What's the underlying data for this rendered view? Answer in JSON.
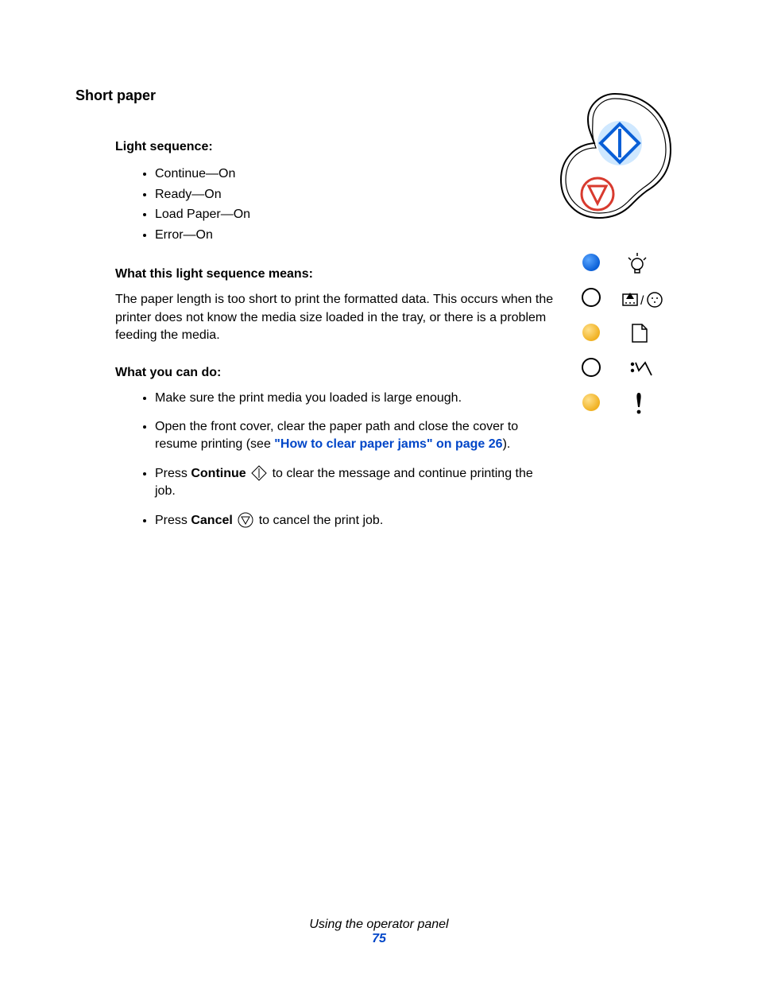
{
  "title": "Short paper",
  "light_sequence": {
    "heading": "Light sequence:",
    "items": [
      "Continue—On",
      "Ready—On",
      "Load Paper—On",
      "Error—On"
    ]
  },
  "meaning": {
    "heading": "What this light sequence means:",
    "text": "The paper length is too short to print the formatted data. This occurs when the printer does not know the media size loaded in the tray, or there is a problem feeding the media."
  },
  "actions": {
    "heading": "What you can do:",
    "item1": "Make sure the print media you loaded is large enough.",
    "item2_pre": "Open the front cover, clear the paper path and close the cover to resume printing (see ",
    "item2_link": "\"How to clear paper jams\" on page 26",
    "item2_post": ").",
    "item3_pre": "Press ",
    "item3_bold": "Continue",
    "item3_post": " to clear the message and continue printing the job.",
    "item4_pre": "Press ",
    "item4_bold": "Cancel",
    "item4_post": " to cancel the print job."
  },
  "footer": {
    "section": "Using the operator panel",
    "page": "75"
  }
}
